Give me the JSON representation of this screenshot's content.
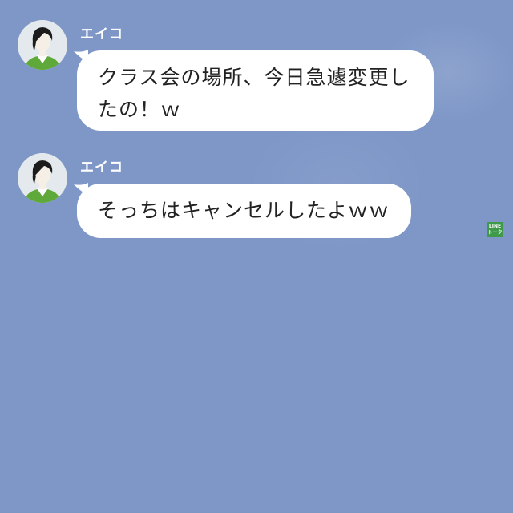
{
  "chat": {
    "messages": [
      {
        "sender": "エイコ",
        "text": "クラス会の場所、今日急遽変更し\nたの！ｗ"
      },
      {
        "sender": "エイコ",
        "text": "そっちはキャンセルしたよｗｗ"
      }
    ]
  },
  "watermark": {
    "line1": "LINE",
    "line2": "トーク"
  },
  "colors": {
    "background": "#7e97c7",
    "bubble": "#ffffff",
    "sender_text": "#ffffff",
    "message_text": "#222222",
    "avatar_shirt": "#5fa83a",
    "badge": "#3e9a49"
  }
}
